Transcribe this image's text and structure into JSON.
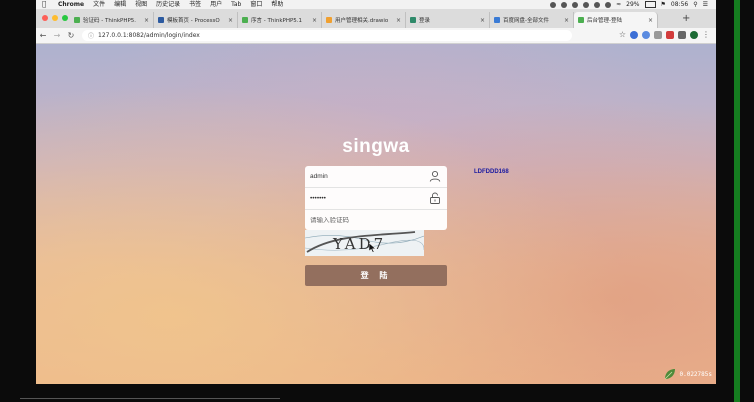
{
  "menubar": {
    "app": "Chrome",
    "items": [
      "文件",
      "编辑",
      "视图",
      "历史记录",
      "书签",
      "用户",
      "Tab",
      "窗口",
      "帮助"
    ],
    "battery": "29%",
    "time": "08:56"
  },
  "tabs": [
    {
      "label": "验证码 - ThinkPHP5.",
      "color": "#4caf50"
    },
    {
      "label": "模板首页 - ProcessO",
      "color": "#2c5aa0"
    },
    {
      "label": "序言 - ThinkPHP5.1",
      "color": "#4caf50"
    },
    {
      "label": "用户管理相关.drawio",
      "color": "#f0a030"
    },
    {
      "label": "登录",
      "color": "#2f8a6a"
    },
    {
      "label": "百度网盘-全部文件",
      "color": "#3a7bd5"
    },
    {
      "label": "后台管理-登陆",
      "color": "#4caf50",
      "active": true
    }
  ],
  "url": "127.0.0.1:8082/admin/login/index",
  "page": {
    "brand": "singwa",
    "username_value": "admin",
    "password_value": "•••••••",
    "captcha_placeholder": "请输入验证码",
    "captcha_code": "LDFDDD168",
    "captcha_image_text": "YAD7",
    "login_label": "登 陆",
    "timer": "0.022785s"
  }
}
